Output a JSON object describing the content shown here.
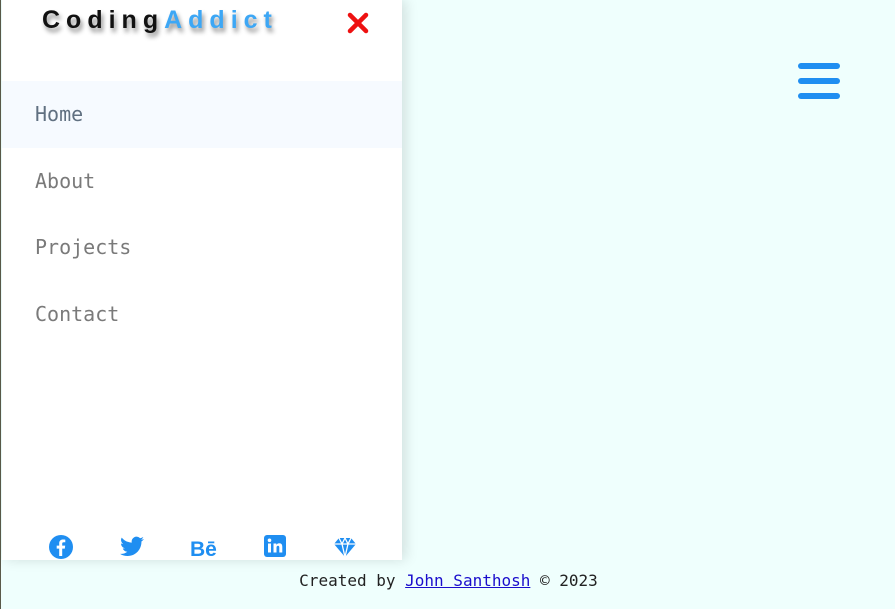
{
  "brand": {
    "part1": "Coding",
    "part2": "Addict"
  },
  "close_button": {
    "icon": "close-icon",
    "color": "#ee1111"
  },
  "nav": {
    "items": [
      {
        "label": "Home",
        "active": true
      },
      {
        "label": "About",
        "active": false
      },
      {
        "label": "Projects",
        "active": false
      },
      {
        "label": "Contact",
        "active": false
      }
    ]
  },
  "socials": [
    {
      "icon": "facebook-icon"
    },
    {
      "icon": "twitter-icon"
    },
    {
      "icon": "behance-icon",
      "text": "Bē"
    },
    {
      "icon": "linkedin-icon"
    },
    {
      "icon": "diamond-icon"
    }
  ],
  "menu_button": {
    "icon": "hamburger-icon",
    "color": "#1f8ef1"
  },
  "footer": {
    "prefix": "Created by",
    "author": "John Santhosh",
    "suffix": "© 2023"
  },
  "colors": {
    "accent": "#1f8ef1",
    "brand_accent": "#3da7f5",
    "background": "#effffd"
  }
}
